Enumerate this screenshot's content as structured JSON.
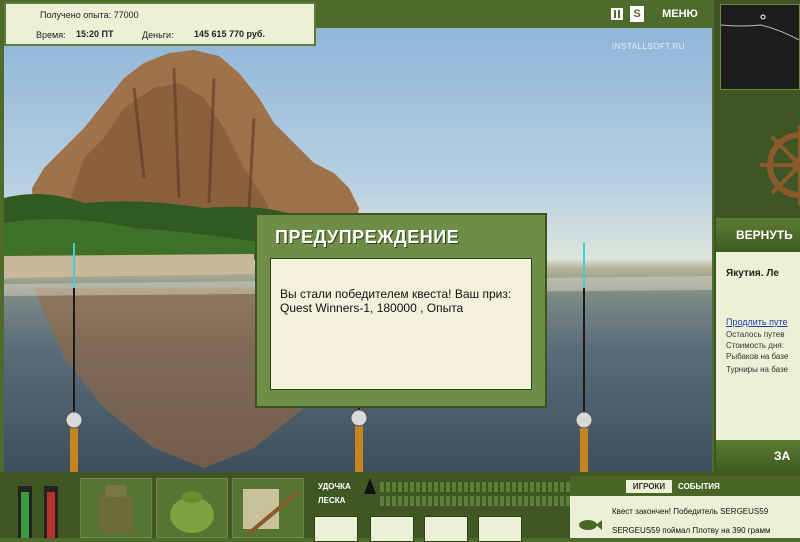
{
  "info": {
    "experience_label": "Получено опыта:",
    "experience_value": "77000",
    "time_label": "Время:",
    "time_value": "15:20 ПТ",
    "money_label": "Деньги:",
    "money_value": "145 615 770 руб."
  },
  "top": {
    "pause_icon": "pause-icon",
    "s_button": "S",
    "menu_label": "МЕНЮ"
  },
  "watermark": "INSTALLSOFT.RU",
  "dialog": {
    "title": "ПРЕДУПРЕЖДЕНИЕ",
    "message": "Вы стали победителем квеста! Ваш приз: Quest Winners-1, 180000 , Опыта"
  },
  "right_panel": {
    "return_label": "ВЕРНУТЬ",
    "location": "Якутия. Ле",
    "extend_link": "Продлить путе",
    "days_left": "Осталось путев",
    "day_cost": "Стоимость дня:",
    "fishers": "Рыбаков на базе",
    "tournaments": "Турниры на базе",
    "bottom_label": "ЗА"
  },
  "bottom": {
    "rod_label": "УДОЧКА",
    "line_label": "ЛЕСКА",
    "tab_players": "ИГРОКИ",
    "tab_events": "СОБЫТИЯ",
    "chat": [
      "Квест закончен! Победитель SERGEUS59",
      "SERGEUS59 поймал Плотву на 390 грамм"
    ]
  },
  "colors": {
    "panel_green": "#4f6b2c",
    "dialog_green": "#6e8d46",
    "paper": "#eef0d6"
  }
}
